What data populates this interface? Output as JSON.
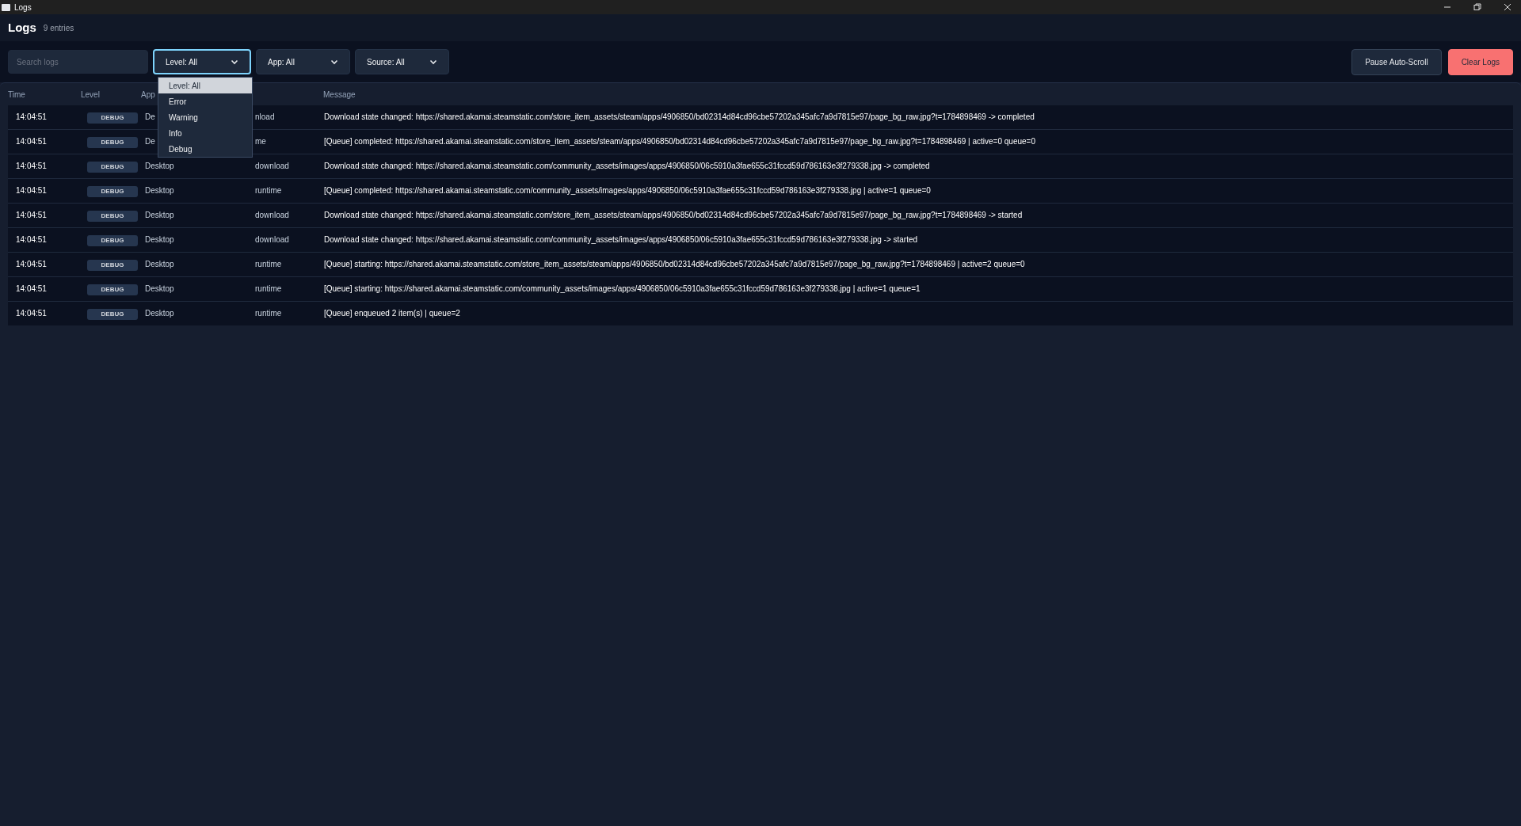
{
  "window": {
    "title": "Logs"
  },
  "header": {
    "title": "Logs",
    "count": "9 entries"
  },
  "toolbar": {
    "search": {
      "placeholder": "Search logs"
    },
    "filters": [
      {
        "label": "Level: All",
        "focused": true
      },
      {
        "label": "App: All",
        "focused": false
      },
      {
        "label": "Source: All",
        "focused": false
      }
    ],
    "buttons": [
      {
        "label": "Pause Auto-Scroll",
        "kind": "secondary"
      },
      {
        "label": "Clear Logs",
        "kind": "danger"
      }
    ]
  },
  "dropdown": {
    "options": [
      {
        "label": "Level: All",
        "selected": true
      },
      {
        "label": "Error",
        "selected": false
      },
      {
        "label": "Warning",
        "selected": false
      },
      {
        "label": "Info",
        "selected": false
      },
      {
        "label": "Debug",
        "selected": false
      }
    ]
  },
  "table": {
    "columns": [
      "Time",
      "Level",
      "App",
      "Message"
    ],
    "rows": [
      {
        "time": "14:04:51",
        "level": "DEBUG",
        "app": "De",
        "source": "nload",
        "message": "Download state changed: https://shared.akamai.steamstatic.com/store_item_assets/steam/apps/4906850/bd02314d84cd96cbe57202a345afc7a9d7815e97/page_bg_raw.jpg?t=1784898469 -> completed"
      },
      {
        "time": "14:04:51",
        "level": "DEBUG",
        "app": "De",
        "source": "me",
        "message": "[Queue] completed: https://shared.akamai.steamstatic.com/store_item_assets/steam/apps/4906850/bd02314d84cd96cbe57202a345afc7a9d7815e97/page_bg_raw.jpg?t=1784898469 | active=0 queue=0"
      },
      {
        "time": "14:04:51",
        "level": "DEBUG",
        "app": "Desktop",
        "source": "download",
        "message": "Download state changed: https://shared.akamai.steamstatic.com/community_assets/images/apps/4906850/06c5910a3fae655c31fccd59d786163e3f279338.jpg -> completed"
      },
      {
        "time": "14:04:51",
        "level": "DEBUG",
        "app": "Desktop",
        "source": "runtime",
        "message": "[Queue] completed: https://shared.akamai.steamstatic.com/community_assets/images/apps/4906850/06c5910a3fae655c31fccd59d786163e3f279338.jpg | active=1 queue=0"
      },
      {
        "time": "14:04:51",
        "level": "DEBUG",
        "app": "Desktop",
        "source": "download",
        "message": "Download state changed: https://shared.akamai.steamstatic.com/store_item_assets/steam/apps/4906850/bd02314d84cd96cbe57202a345afc7a9d7815e97/page_bg_raw.jpg?t=1784898469 -> started"
      },
      {
        "time": "14:04:51",
        "level": "DEBUG",
        "app": "Desktop",
        "source": "download",
        "message": "Download state changed: https://shared.akamai.steamstatic.com/community_assets/images/apps/4906850/06c5910a3fae655c31fccd59d786163e3f279338.jpg -> started"
      },
      {
        "time": "14:04:51",
        "level": "DEBUG",
        "app": "Desktop",
        "source": "runtime",
        "message": "[Queue] starting: https://shared.akamai.steamstatic.com/store_item_assets/steam/apps/4906850/bd02314d84cd96cbe57202a345afc7a9d7815e97/page_bg_raw.jpg?t=1784898469 | active=2 queue=0"
      },
      {
        "time": "14:04:51",
        "level": "DEBUG",
        "app": "Desktop",
        "source": "runtime",
        "message": "[Queue] starting: https://shared.akamai.steamstatic.com/community_assets/images/apps/4906850/06c5910a3fae655c31fccd59d786163e3f279338.jpg | active=1 queue=1"
      },
      {
        "time": "14:04:51",
        "level": "DEBUG",
        "app": "Desktop",
        "source": "runtime",
        "message": "[Queue] enqueued 2 item(s) | queue=2"
      }
    ]
  }
}
